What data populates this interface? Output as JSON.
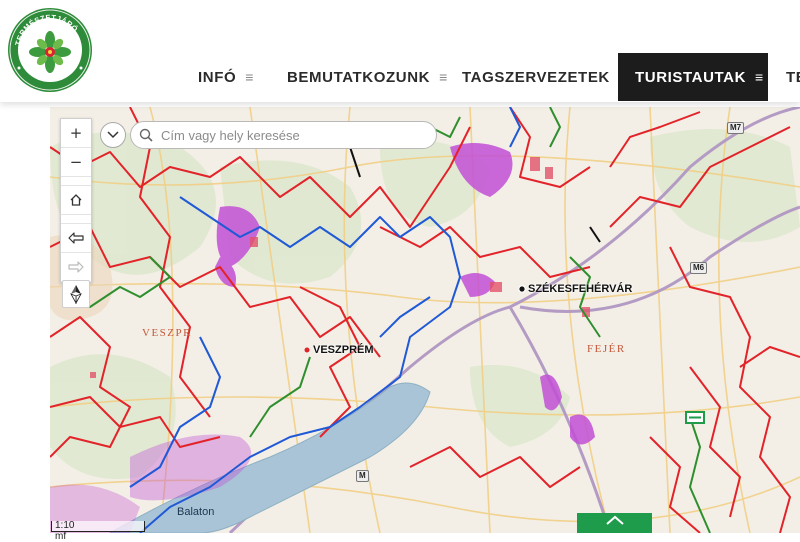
{
  "header": {
    "logo": {
      "ring_text_top": "TERMÉSZETJÁRÓ",
      "ring_text_left": "MAGYAR",
      "ring_text_right": "SZÖVETSÉG",
      "brand_green": "#2e8b3a"
    },
    "nav": [
      {
        "label": "INFÓ",
        "active": false
      },
      {
        "label": "BEMUTATKOZUNK",
        "active": false
      },
      {
        "label": "TAGSZERVEZETEK",
        "active": false
      },
      {
        "label": "TURISTAUTAK",
        "active": true
      },
      {
        "label": "TE",
        "active": false
      }
    ],
    "menu_icon": "≡"
  },
  "map": {
    "search_placeholder": "Cím vagy hely keresése",
    "controls": {
      "zoom_in": "+",
      "zoom_out": "−",
      "home": "home-icon",
      "back": "arrow-left-icon",
      "forward": "arrow-right-icon",
      "compass": "north-arrow-icon"
    },
    "labels": {
      "city_veszprem": "VESZPRÉM",
      "city_szekesfehervar": "SZÉKESFEHÉRVÁR",
      "county_veszprem": "VESZPR",
      "county_fejer": "FEJÉR",
      "lake_balaton": "Balaton"
    },
    "roads": [
      "M7",
      "M6",
      "M"
    ],
    "scale": "1:10 mf",
    "colors": {
      "red_trail": "#e2232a",
      "blue_trail": "#2059d6",
      "green_trail": "#2f8f2f",
      "purple_area": "#c24fd6",
      "lake": "#a9c4d6",
      "base": "#f3efe6",
      "back_to_top": "#1e9b4b"
    }
  }
}
